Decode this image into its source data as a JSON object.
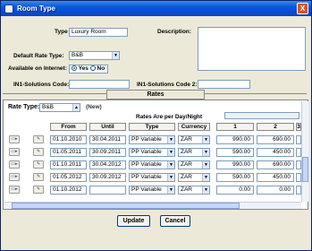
{
  "window": {
    "title": "Room Type",
    "close_glyph": "X"
  },
  "form": {
    "type_label": "Type",
    "type_value": "Luxury Room",
    "description_label": "Description:",
    "default_rate_type_label": "Default Rate Type:",
    "default_rate_type_value": "B&B",
    "available_on_internet_label": "Available on Internet:",
    "yes_label": "Yes",
    "no_label": "No",
    "in1_code_label": "IN1-Solutions Code:",
    "in1_code2_label": "IN1-Solutions Code 2:"
  },
  "rates": {
    "section_title": "Rates",
    "rate_type_label": "Rate Type:",
    "rate_type_value": "B&B",
    "new_label": "(New)",
    "per_label": "Rates Are per Day/Night",
    "headers": {
      "from": "From",
      "until": "Until",
      "type": "Type",
      "currency": "Currency",
      "c1": "1",
      "c2": "2",
      "c3": "3"
    },
    "rows": [
      {
        "from": "01.10.2010",
        "until": "30.04.2011",
        "type": "PP Variable",
        "currency": "ZAR",
        "r1": "990.00",
        "r2": "690.00"
      },
      {
        "from": "01.05.2011",
        "until": "30.09.2011",
        "type": "PP Variable",
        "currency": "ZAR",
        "r1": "590.00",
        "r2": "450.00"
      },
      {
        "from": "01.10.2011",
        "until": "30.04.2012",
        "type": "PP Variable",
        "currency": "ZAR",
        "r1": "990.00",
        "r2": "690.00"
      },
      {
        "from": "01.05.2012",
        "until": "30.09.2012",
        "type": "PP Variable",
        "currency": "ZAR",
        "r1": "590.00",
        "r2": "450.00"
      },
      {
        "from": "01.10.2012",
        "until": "",
        "type": "PP Variable",
        "currency": "ZAR",
        "r1": "0.00",
        "r2": "0.00"
      }
    ]
  },
  "buttons": {
    "update": "Update",
    "cancel": "Cancel"
  }
}
